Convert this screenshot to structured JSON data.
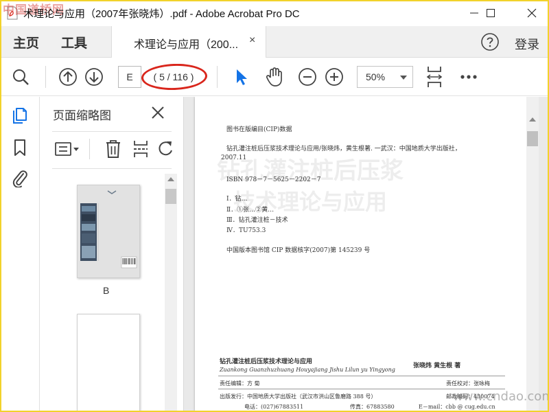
{
  "window": {
    "title": "术理论与应用（2007年张晓炜）.pdf - Adobe Acrobat Pro DC",
    "watermark_logo": "中国道桥网"
  },
  "menu": {
    "home": "主页",
    "tools": "工具",
    "login": "登录"
  },
  "tab": {
    "label": "术理论与应用（200...",
    "close": "×"
  },
  "toolbar": {
    "page_input": "E",
    "page_count": "( 5 / 116 )",
    "zoom": "50%",
    "icons": [
      "search-icon",
      "page-up-icon",
      "page-down-icon",
      "select-cursor-icon",
      "hand-tool-icon",
      "zoom-out-icon",
      "zoom-in-icon",
      "fit-page-icon",
      "more-icon"
    ]
  },
  "thumbnail_panel": {
    "title": "页面缩略图",
    "thumbnails": [
      {
        "label": "B"
      }
    ]
  },
  "document": {
    "cip_header": "图书在版编目(CIP)数据",
    "cip_entry_1": "钻孔灌注桩后压浆技术理论与应用/张晓炜，黄生根著. 一武汉：中国地质大学出版社，",
    "cip_entry_2": "2007.11",
    "isbn": "ISBN 978－7－5625－2202－7",
    "subject_1": "Ⅰ．钻…",
    "subject_2": "Ⅱ．①张…②黄…",
    "subject_3": "Ⅲ．钻孔灌注桩－技术",
    "subject_4": "Ⅳ．TU753.3",
    "cip_number": "中国版本图书馆 CIP 数据核字(2007)第 145239 号",
    "book_title": "钻孔灌注桩后压浆技术理论与应用",
    "book_title_pinyin": "Zuankong Guanzhuzhuang Houyajiang Jishu Lilun yu Yingyong",
    "authors": "张晓炜   黄生根   著",
    "editor": "责任编辑：方   菊",
    "proofreader": "责任校对：张咏梅",
    "publisher": "出版发行：中国地质大学出版社（武汉市洪山区鲁磨路 388 号）",
    "postcode": "邮政编码：430074",
    "phone": "电话：(027)67883511",
    "fax": "传真：67883580",
    "email": "E－mail：cbb @ cug.edu.cn",
    "site_watermark": "www.cndao.com"
  },
  "colors": {
    "accent_blue": "#1473e6",
    "annotation_red": "#d9261c",
    "frame_yellow": "#f2d22b"
  }
}
